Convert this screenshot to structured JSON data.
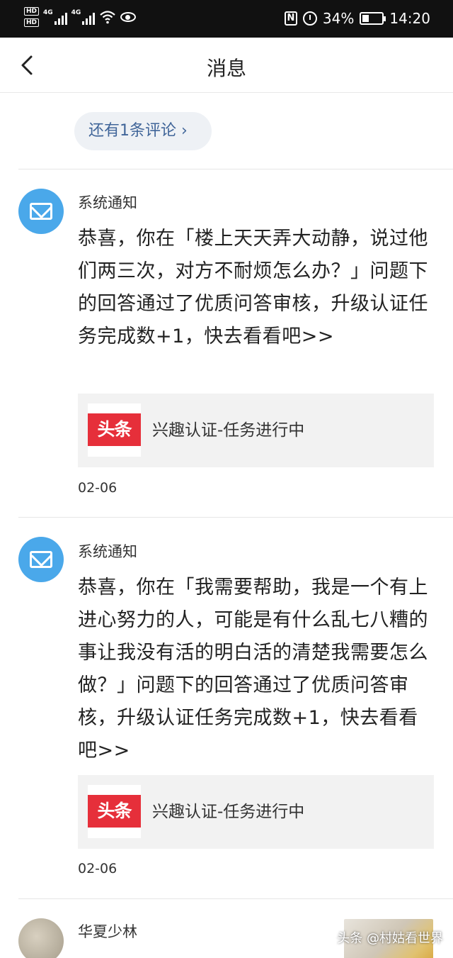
{
  "status_bar": {
    "network_1": "HD",
    "network_2": "HD",
    "signal_label": "4G",
    "battery": "34%",
    "battery_level": 0.34,
    "time": "14:20"
  },
  "nav": {
    "title": "消息"
  },
  "more_comments": "还有1条评论 ›",
  "notifications": [
    {
      "sender": "系统通知",
      "message": "恭喜，你在「楼上天天弄大动静，说过他们两三次，对方不耐烦怎么办？」问题下的回答通过了优质问答审核，升级认证任务完成数+1，快去看看吧>>",
      "task_logo": "头条",
      "task_text": "兴趣认证-任务进行中",
      "date": "02-06"
    },
    {
      "sender": "系统通知",
      "message": "恭喜，你在「我需要帮助，我是一个有上进心努力的人，可能是有什么乱七八糟的事让我没有活的明白活的清楚我需要怎么做？」问题下的回答通过了优质问答审核，升级认证任务完成数+1，快去看看吧>>",
      "task_logo": "头条",
      "task_text": "兴趣认证-任务进行中",
      "date": "02-06"
    }
  ],
  "third_item": {
    "sender": "华夏少林"
  },
  "watermark": "头条 @村姑看世界",
  "colors": {
    "link_blue": "#406599",
    "mail_avatar": "#4aa8ea",
    "brand_red": "#e62f3a"
  }
}
